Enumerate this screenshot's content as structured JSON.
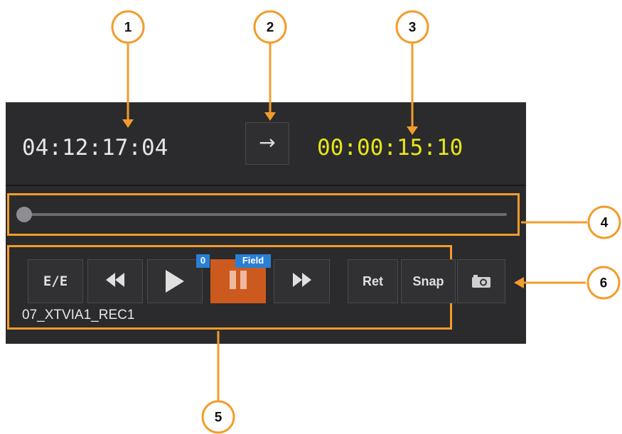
{
  "callouts": [
    "1",
    "2",
    "3",
    "4",
    "5",
    "6"
  ],
  "timecode": {
    "current": "04:12:17:04",
    "direction_symbol": "→",
    "remaining": "00:00:15:10"
  },
  "scrubber": {
    "position": 0.0
  },
  "transport": {
    "ee_label": "E/E",
    "speed_badge": "0",
    "field_badge": "Field",
    "ret_label": "Ret",
    "snap_label": "Snap"
  },
  "clip": {
    "name": "07_XTVIA1_REC1"
  },
  "colors": {
    "callout": "#f39c2b",
    "remaining_timecode": "#e8e61a",
    "pause_active": "#cc5a1e",
    "badge": "#2a7fd4"
  }
}
